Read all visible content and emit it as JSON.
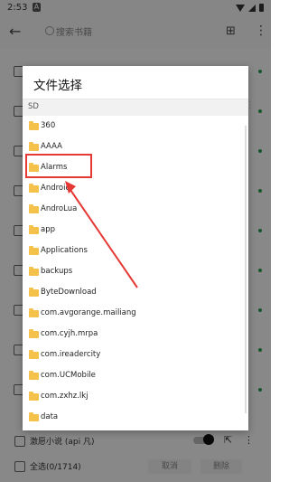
{
  "status_bar": {
    "time": "2:53",
    "notif": "A"
  },
  "app_bar": {
    "search_placeholder": "搜索书籍"
  },
  "dialog": {
    "title": "文件选择",
    "path_label": "SD",
    "items": [
      {
        "label": "360"
      },
      {
        "label": "AAAA"
      },
      {
        "label": "Alarms"
      },
      {
        "label": "Android"
      },
      {
        "label": "AndroLua"
      },
      {
        "label": "app"
      },
      {
        "label": "Applications"
      },
      {
        "label": "backups"
      },
      {
        "label": "ByteDownload"
      },
      {
        "label": "com.avgorange.mailiang"
      },
      {
        "label": "com.cyjh.mrpa"
      },
      {
        "label": "com.ireadercity"
      },
      {
        "label": "com.UCMobile"
      },
      {
        "label": "com.zxhz.lkj"
      },
      {
        "label": "data"
      }
    ]
  },
  "bottom": {
    "book_label": "激愿小说 (api 凡)",
    "select_all": "全选(0/1714)",
    "btn_cancel": "取消",
    "btn_delete": "删除"
  },
  "colors": {
    "highlight": "#e53935",
    "folder": "#f4c24a",
    "green_dot": "#2a9d4b"
  }
}
